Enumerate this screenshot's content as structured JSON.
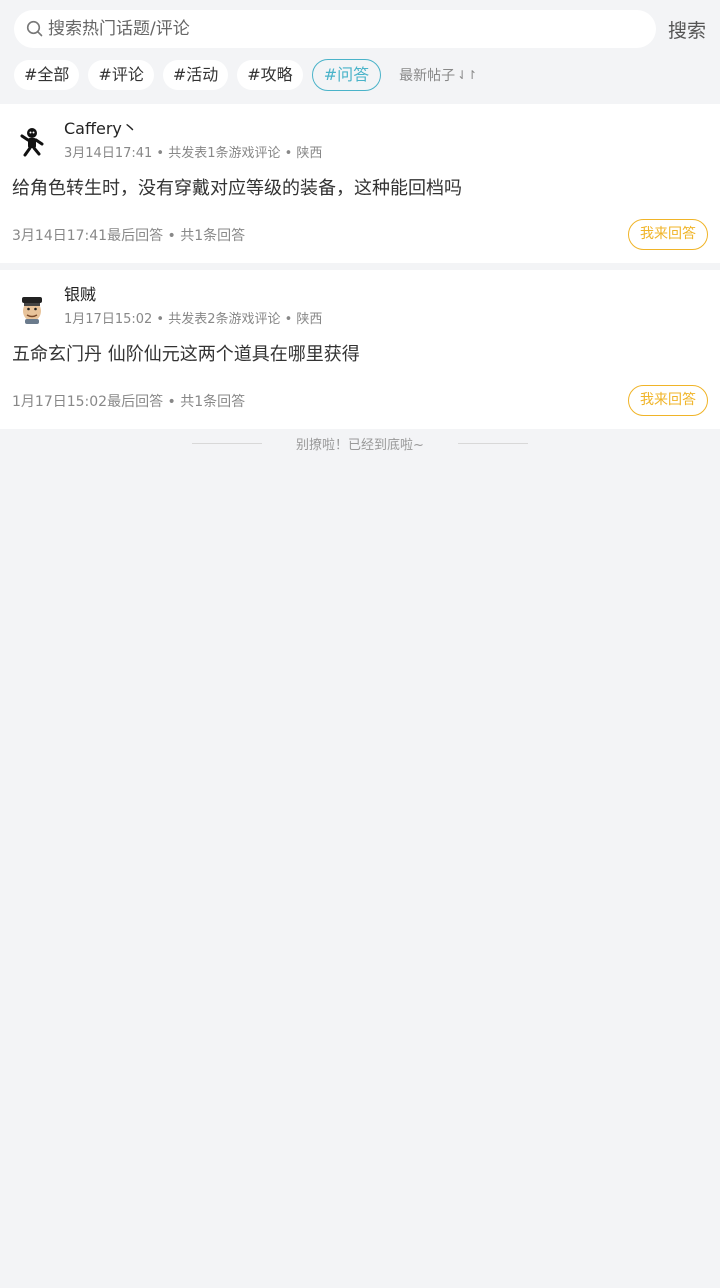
{
  "search": {
    "placeholder": "搜索热门话题/评论",
    "button_label": "搜索"
  },
  "tags": [
    "#全部",
    "#评论",
    "#活动",
    "#攻略",
    "#问答"
  ],
  "sort_label": "最新帖子",
  "posts": [
    {
      "user_name": "Caffery丶",
      "meta": "3月14日17:41 • 共发表1条游戏评论 • 陕西",
      "title": "给角色转生时，没有穿戴对应等级的装备，这种能回档吗",
      "footer": "3月14日17:41最后回答 • 共1条回答",
      "answer_label": "我来回答"
    },
    {
      "user_name": "银贼",
      "meta": "1月17日15:02 • 共发表2条游戏评论 • 陕西",
      "title": "五命玄门丹 仙阶仙元这两个道具在哪里获得",
      "footer": "1月17日15:02最后回答 • 共1条回答",
      "answer_label": "我来回答"
    }
  ],
  "end_text": "别撩啦！已经到底啦~",
  "colors": {
    "accent": "#4ab3c9",
    "answer": "#f0b428",
    "background": "#f3f4f6"
  }
}
